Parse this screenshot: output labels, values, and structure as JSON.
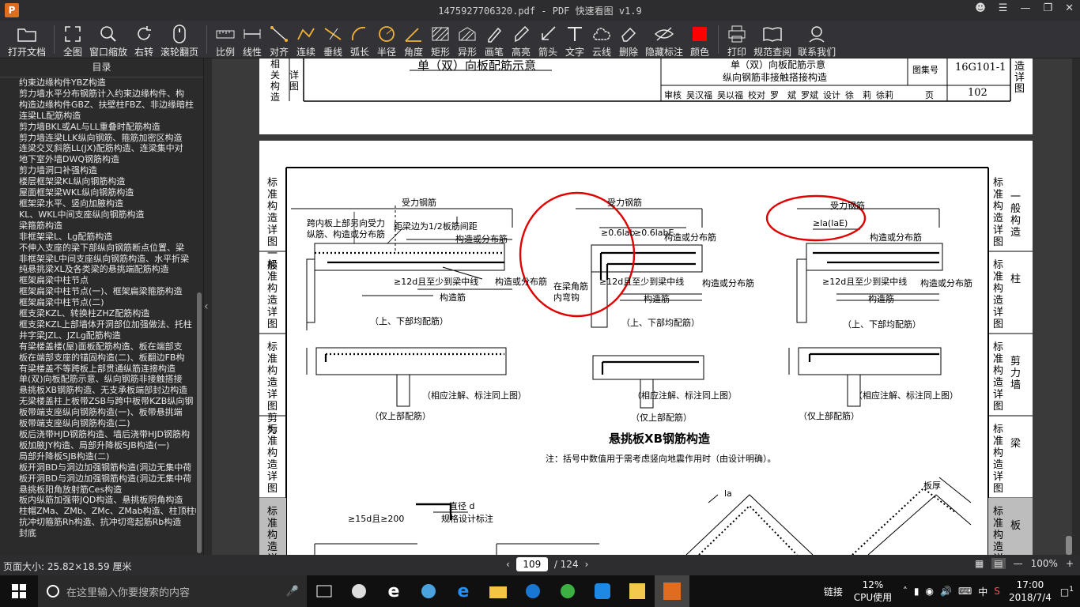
{
  "window": {
    "title": "1475927706320.pdf - PDF 快速看图 v1.9",
    "logo": "P"
  },
  "toolbar": {
    "buttons": [
      {
        "id": "open",
        "label": "打开文档",
        "icon": "folder-icon"
      },
      {
        "id": "fit",
        "label": "全图",
        "icon": "fullscreen-icon"
      },
      {
        "id": "zoom-window",
        "label": "窗口缩放",
        "icon": "magnifier-icon"
      },
      {
        "id": "rotate",
        "label": "右转",
        "icon": "rotate-icon"
      },
      {
        "id": "scroll-page",
        "label": "滚轮翻页",
        "icon": "mouse-icon"
      },
      {
        "id": "scale",
        "label": "比例",
        "icon": "ruler-icon"
      },
      {
        "id": "linear",
        "label": "线性",
        "icon": "linear-dimension-icon"
      },
      {
        "id": "aligned",
        "label": "对齐",
        "icon": "aligned-dimension-icon"
      },
      {
        "id": "continuous",
        "label": "连续",
        "icon": "continuous-dimension-icon"
      },
      {
        "id": "perpendicular",
        "label": "垂线",
        "icon": "perpendicular-icon"
      },
      {
        "id": "arc",
        "label": "弧长",
        "icon": "arc-length-icon"
      },
      {
        "id": "radius",
        "label": "半径",
        "icon": "radius-icon"
      },
      {
        "id": "angle",
        "label": "角度",
        "icon": "angle-icon"
      },
      {
        "id": "rect",
        "label": "矩形",
        "icon": "rectangle-area-icon"
      },
      {
        "id": "irregular",
        "label": "异形",
        "icon": "irregular-area-icon"
      },
      {
        "id": "pen",
        "label": "画笔",
        "icon": "pen-icon"
      },
      {
        "id": "highlight",
        "label": "高亮",
        "icon": "highlighter-icon"
      },
      {
        "id": "arrow",
        "label": "箭头",
        "icon": "arrow-icon"
      },
      {
        "id": "text",
        "label": "文字",
        "icon": "text-icon"
      },
      {
        "id": "cloud",
        "label": "云线",
        "icon": "cloud-icon"
      },
      {
        "id": "delete",
        "label": "删除",
        "icon": "eraser-icon"
      },
      {
        "id": "hide",
        "label": "隐藏标注",
        "icon": "eye-hidden-icon"
      },
      {
        "id": "color",
        "label": "颜色",
        "icon": "color-swatch-icon"
      },
      {
        "id": "print",
        "label": "打印",
        "icon": "printer-icon"
      },
      {
        "id": "spec",
        "label": "规范查阅",
        "icon": "book-icon"
      },
      {
        "id": "contact",
        "label": "联系我们",
        "icon": "support-agent-icon"
      }
    ],
    "color_swatch": "#ff0000"
  },
  "sidebar": {
    "header": "目录",
    "items": [
      "约束边缘构件YBZ构造",
      "剪力墙水平分布钢筋计入约束边缘构件、构",
      "构造边缘构件GBZ、扶壁柱FBZ、非边缘暗柱",
      "连梁LL配筋构造",
      "剪力墙BKL或AL与LL重叠时配筋构造",
      "剪力墙连梁LLK纵向钢筋、箍筋加密区构造",
      "连梁交叉斜筋LL(JX)配筋构造、连梁集中对",
      "地下室外墙DWQ钢筋构造",
      "剪力墙洞口补强构造",
      "楼层框架梁KL纵向钢筋构造",
      "屋面框架梁WKL纵向钢筋构造",
      "框架梁水平、竖向加腋构造",
      "KL、WKL中间支座纵向钢筋构造",
      "梁箍筋构造",
      "非框架梁L、Lg配筋构造",
      "不伸入支座的梁下部纵向钢筋断点位置、梁",
      "非框架梁L中间支座纵向钢筋构造、水平折梁",
      "纯悬挑梁XL及各类梁的悬挑端配筋构造",
      "框架扁梁中柱节点",
      "框架扁梁中柱节点(一)、框架扁梁箍筋构造",
      "框架扁梁中柱节点(二)",
      "框支梁KZL、转换柱ZHZ配筋构造",
      "框支梁KZL上部墙体开洞部位加强做法、托柱",
      "井字梁JZL、JZLg配筋构造",
      "有梁楼盖楼(屋)面板配筋构造、板在端部支",
      "板在端部支座的锚固构造(二)、板翻边FB构",
      "有梁楼盖不等跨板上部贯通纵筋连接构造",
      "单(双)向板配筋示意、纵向钢筋非接触搭接",
      "悬挑板XB钢筋构造、无支承板端部封边构造",
      "无梁楼盖柱上板带ZSB与跨中板带KZB纵向钢",
      "板带端支座纵向钢筋构造(一)、板带悬挑端",
      "板带端支座纵向钢筋构造(二)",
      "板后浇带HJD钢筋构造、墙后浇带HJD钢筋构",
      "板加腋JY构造、局部升降板SJB构造(一)",
      "局部升降板SJB构造(二)",
      "板开洞BD与洞边加强钢筋构造(洞边无集中荷",
      "板开洞BD与洞边加强钢筋构造(洞边无集中荷",
      "悬挑板阳角放射筋Ces构造",
      "板内纵筋加强带JQD构造、悬挑板阴角构造",
      "柱帽ZMa、ZMb、ZMc、ZMab构造、柱顶柱帽",
      "抗冲切箍筋Rh构造、抗冲切弯起筋Rb构造",
      "封底"
    ]
  },
  "page_top": {
    "side_labels": [
      "相",
      "关",
      "构",
      "造",
      "详",
      "图"
    ],
    "drawing_title": "单（双）向板配筋示意",
    "tb_title1": "单（双）向板配筋示意",
    "tb_title2": "纵向钢筋非接触搭接构造",
    "atlas_label": "图集号",
    "atlas_no": "16G101-1",
    "page_label": "页",
    "page_no": "102",
    "sign_row": [
      "审核",
      "吴汉福",
      "吴以福",
      "校对",
      "罗　斌",
      "罗斌",
      "设计",
      "徐　莉",
      "徐莉"
    ],
    "right_tab": [
      "造",
      "详",
      "图"
    ]
  },
  "page_main": {
    "left_tabs": [
      {
        "text": [
          "标",
          "准",
          "构",
          "造",
          "详",
          "图"
        ],
        "sub": "一般"
      },
      {
        "text": [
          "标",
          "准",
          "构",
          "造",
          "详",
          "图"
        ],
        "sub": ""
      },
      {
        "text": [
          "标",
          "准",
          "构",
          "造",
          "详",
          "图"
        ],
        "sub": "剪力"
      },
      {
        "text": [
          "标",
          "准",
          "构",
          "造",
          "详",
          "图"
        ],
        "sub": ""
      },
      {
        "text": [
          "标",
          "准",
          "构",
          "造",
          "详",
          "图"
        ],
        "sub": ""
      }
    ],
    "right_tabs": [
      {
        "text": "标准构造详图",
        "sub": "一般构造"
      },
      {
        "text": "标准构造详图",
        "sub": "柱"
      },
      {
        "text": "标准构造详图",
        "sub": "剪力墙"
      },
      {
        "text": "标准构造详图",
        "sub": "梁"
      },
      {
        "text": "标准构造详图",
        "sub": "板"
      }
    ],
    "labels": {
      "force_bar": "受力钢筋",
      "left_note1": "跨内板上部另向受力",
      "left_note2": "纵筋、构造或分布筋",
      "dist_note": "距梁边为1/2板筋间距",
      "struct_or_dist": "构造或分布筋",
      "struct_bar": "构造筋",
      "extend": "≥12d且至少到梁中线",
      "lab_upper_lower": "（上、下部均配筋）",
      "lab_upper_only": "（仅上部配筋）",
      "same_note": "（相应注解、标注同上图）",
      "inner_hook1": "在梁角筋",
      "inner_hook2": "内弯钩",
      "dim_06lab": "≥0.6lab",
      "dim_06labE": "≥0.6labE",
      "dim_la": "≥la(laE)",
      "lab_ilab": "(la)",
      "title_xb": "悬挑板XB钢筋构造",
      "note": "注：括号中数值用于需考虑竖向地震作用时（由设计明确）。",
      "dia_d": "直径 d",
      "std_hook": "规格设计标注",
      "ge15d": "≥15d且≥200",
      "thick": "板厚",
      "dim_la2": "la"
    }
  },
  "status": {
    "page_size": "页面大小: 25.82×18.59 厘米",
    "current_page": "109",
    "total_pages": "/ 124",
    "zoom": "100%"
  },
  "taskbar": {
    "search_placeholder": "在这里输入你要搜索的内容",
    "link_label": "链接",
    "cpu_percent": "12%",
    "cpu_label": "CPU使用",
    "ime": "中",
    "time": "17:00",
    "date": "2018/7/4",
    "notif_count": "1"
  }
}
